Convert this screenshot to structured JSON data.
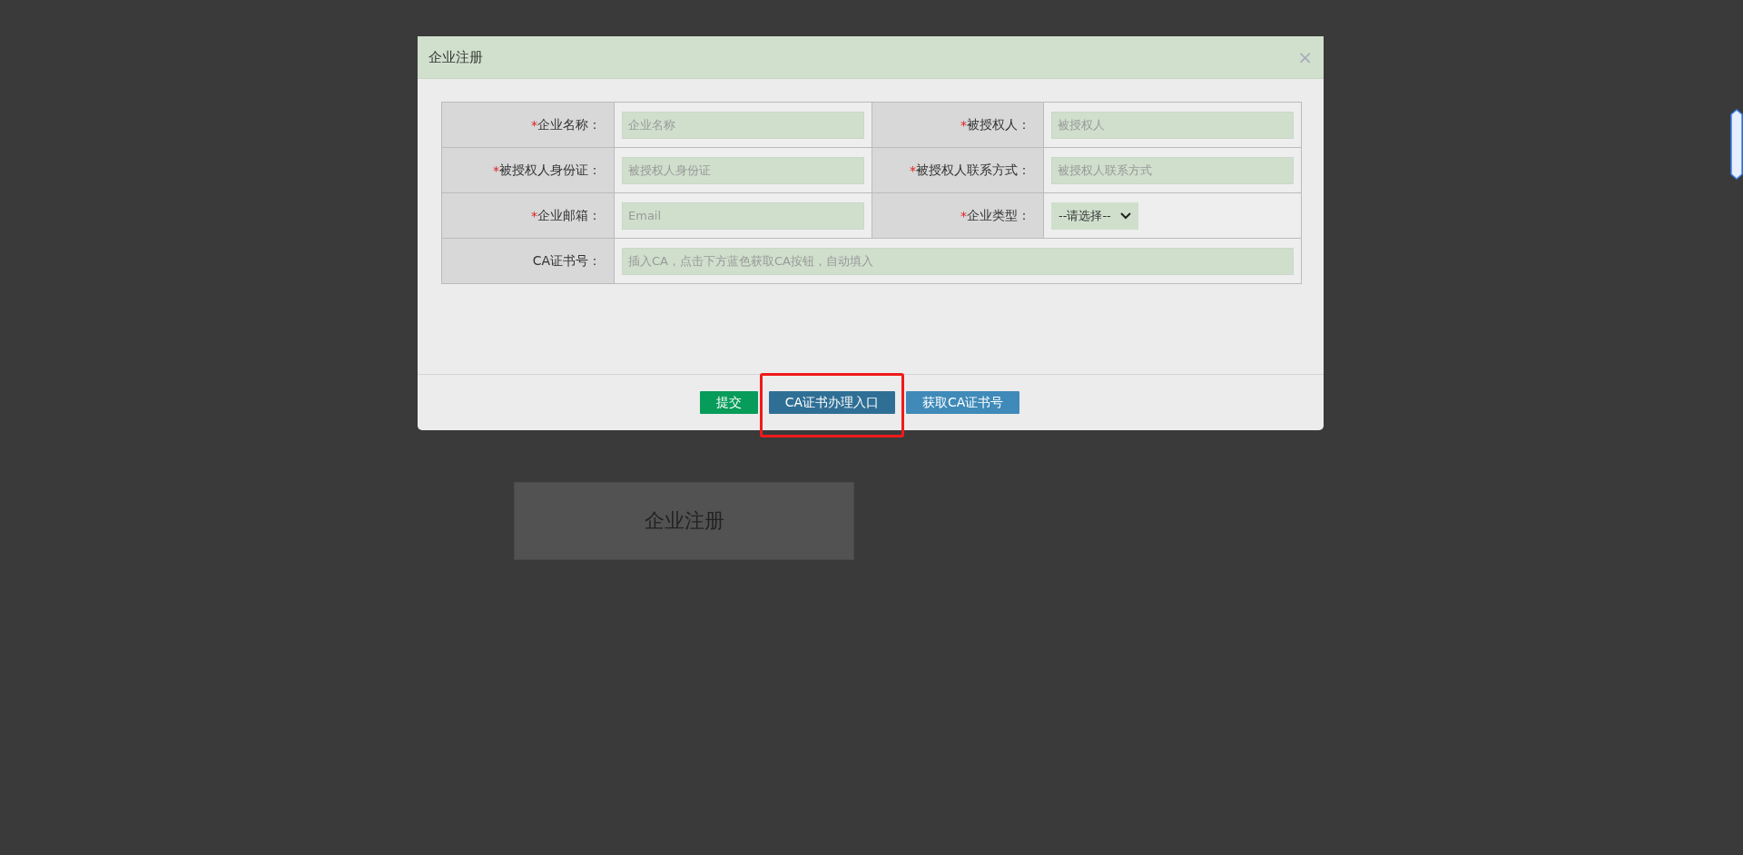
{
  "dialog": {
    "title": "企业注册",
    "close": "×"
  },
  "fields": [
    {
      "kind": "text",
      "mark": "*",
      "label": "企业名称：",
      "placeholder": "企业名称"
    },
    {
      "kind": "text",
      "mark": "*",
      "label": "被授权人：",
      "placeholder": "被授权人"
    },
    {
      "kind": "text",
      "mark": "*",
      "label": "被授权人身份证：",
      "placeholder": "被授权人身份证"
    },
    {
      "kind": "text",
      "mark": "*",
      "label": "被授权人联系方式：",
      "placeholder": "被授权人联系方式"
    },
    {
      "kind": "text",
      "mark": "*",
      "label": "企业邮箱：",
      "placeholder": "Email"
    },
    {
      "kind": "select",
      "mark": "*",
      "label": "企业类型：",
      "value": "--请选择--"
    },
    {
      "kind": "wide",
      "label": "CA证书号：",
      "placeholder": "插入CA，点击下方蓝色获取CA按钮，自动填入"
    }
  ],
  "buttons": [
    {
      "kind": "success",
      "label": "提交",
      "highlighted": false
    },
    {
      "kind": "primary",
      "label": "CA证书办理入口",
      "highlighted": true
    },
    {
      "kind": "info",
      "label": "获取CA证书号",
      "highlighted": false
    }
  ],
  "page_card": {
    "label": "企业注册"
  }
}
